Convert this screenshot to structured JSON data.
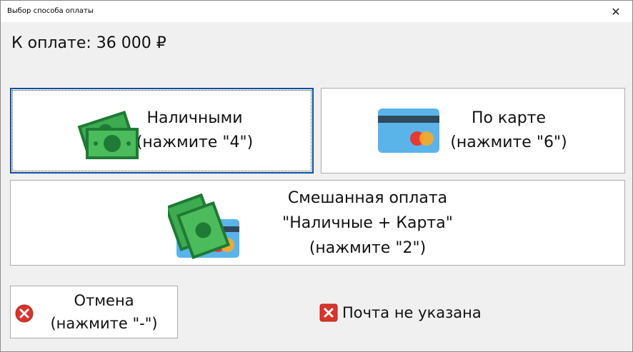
{
  "window": {
    "title": "Выбор способа оплаты",
    "close_glyph": "✕"
  },
  "amount_text": "К оплате: 36 000 ₽",
  "buttons": {
    "cash": {
      "label": "Наличными\n(нажмите \"4\")",
      "icon": "cash-icon"
    },
    "card": {
      "label": "По карте\n(нажмите \"6\")",
      "icon": "credit-card-icon"
    },
    "mixed": {
      "label": "Смешанная оплата\n\"Наличные + Карта\"\n(нажмите \"2\")",
      "icon": "cash-and-card-icon"
    },
    "cancel": {
      "label": "Отмена\n(нажмите \"-\")",
      "icon": "cancel-icon"
    }
  },
  "email_status": {
    "text": "Почта не указана",
    "icon": "error-icon"
  },
  "colors": {
    "cash_dark": "#1e7a35",
    "cash_light": "#3dab4f",
    "card_blue": "#5ab4ea",
    "card_stripe": "#2e4a5c",
    "mastercard_red": "#e53935",
    "mastercard_orange": "#f9a825",
    "error_red": "#d9342b",
    "focus_border": "#0a4fa0"
  }
}
